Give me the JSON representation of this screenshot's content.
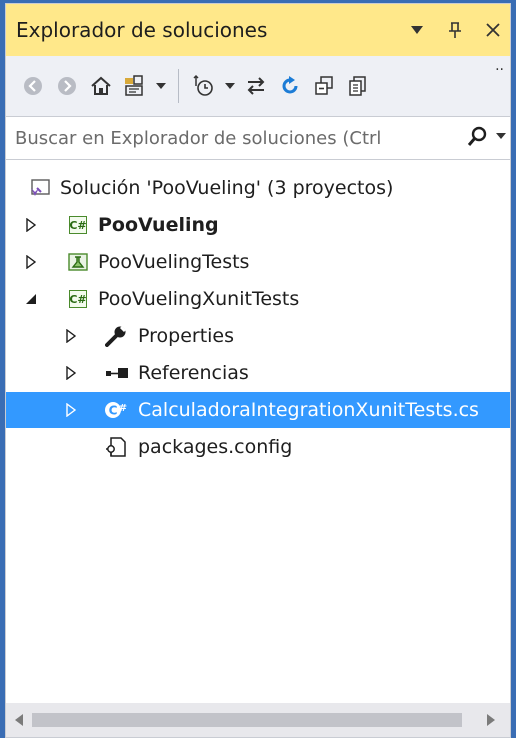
{
  "panel": {
    "title": "Explorador de soluciones",
    "actions": [
      "▾",
      "ᛘ",
      "✕"
    ]
  },
  "toolbar": {
    "icons": [
      "back-icon",
      "forward-icon",
      "home-icon",
      "solutions-view-icon",
      "dropdown-icon",
      "pending-changes-icon",
      "dropdown-icon",
      "sync-icon",
      "refresh-icon",
      "collapse-all-icon",
      "show-all-files-icon"
    ],
    "more": "··"
  },
  "search": {
    "placeholder": "Buscar en Explorador de soluciones (Ctrl"
  },
  "tree": {
    "solution": "Solución 'PooVueling'  (3 proyectos)",
    "projects": [
      {
        "label": "PooVueling",
        "bold": true
      },
      {
        "label": "PooVuelingTests",
        "bold": false
      },
      {
        "label": "PooVuelingXunitTests",
        "bold": false
      }
    ],
    "children": [
      {
        "label": "Properties"
      },
      {
        "label": "Referencias"
      },
      {
        "label": "CalculadoraIntegrationXunitTests.cs",
        "selected": true
      },
      {
        "label": "packages.config"
      }
    ]
  },
  "colors": {
    "title_bg": "#ffe88a",
    "toolbar_bg": "#eef0f5",
    "selection": "#3399ff",
    "frame": "#3a6db4"
  }
}
